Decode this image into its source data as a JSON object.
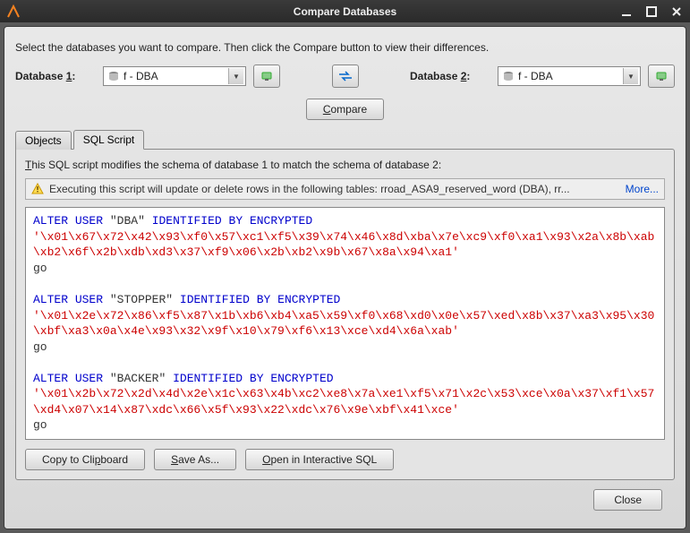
{
  "window": {
    "title": "Compare Databases"
  },
  "instruction": "Select the databases you want to compare. Then click the Compare button to view their differences.",
  "db1": {
    "label_pre": "Database ",
    "label_u": "1",
    "label_post": ":",
    "value": "f - DBA"
  },
  "db2": {
    "label_pre": "Database ",
    "label_u": "2",
    "label_post": ":",
    "value": "f - DBA"
  },
  "compare_btn": "Compare",
  "tabs": {
    "objects": "Objects",
    "sql": "SQL Script"
  },
  "panel_desc_pre": "T",
  "panel_desc_rest": "his SQL script modifies the schema of database 1 to match the schema of database 2:",
  "warning_text": "Executing this script will update or delete rows in the following tables: rroad_ASA9_reserved_word (DBA), rr...",
  "warning_more": "More...",
  "sql": {
    "l1a": "ALTER",
    "l1b": "USER",
    "l1c": "\"DBA\"",
    "l1d": "IDENTIFIED",
    "l1e": "BY",
    "l1f": "ENCRYPTED",
    "s1": "'\\x01\\x67\\x72\\x42\\x93\\xf0\\x57\\xc1\\xf5\\x39\\x74\\x46\\x8d\\xba\\x7e\\xc9\\xf0\\xa1\\x93\\x2a\\x8b\\xab\\xb2\\x6f\\x2b\\xdb\\xd3\\x37\\xf9\\x06\\x2b\\xb2\\x9b\\x67\\x8a\\x94\\xa1'",
    "g1": "go",
    "l2a": "ALTER",
    "l2b": "USER",
    "l2c": "\"STOPPER\"",
    "l2d": "IDENTIFIED",
    "l2e": "BY",
    "l2f": "ENCRYPTED",
    "s2": "'\\x01\\x2e\\x72\\x86\\xf5\\x87\\x1b\\xb6\\xb4\\xa5\\x59\\xf0\\x68\\xd0\\x0e\\x57\\xed\\x8b\\x37\\xa3\\x95\\x30\\xbf\\xa3\\x0a\\x4e\\x93\\x32\\x9f\\x10\\x79\\xf6\\x13\\xce\\xd4\\x6a\\xab'",
    "g2": "go",
    "l3a": "ALTER",
    "l3b": "USER",
    "l3c": "\"BACKER\"",
    "l3d": "IDENTIFIED",
    "l3e": "BY",
    "l3f": "ENCRYPTED",
    "s3": "'\\x01\\x2b\\x72\\x2d\\x4d\\x2e\\x1c\\x63\\x4b\\xc2\\xe8\\x7a\\xe1\\xf5\\x71\\x2c\\x53\\xce\\x0a\\x37\\xf1\\x57\\xd4\\x07\\x14\\x87\\xdc\\x66\\x5f\\x93\\x22\\xdc\\x76\\x9e\\xbf\\x41\\xce'",
    "g3": "go"
  },
  "buttons": {
    "copy": "Copy to Cli",
    "copy_u": "p",
    "copy2": "board",
    "save_u": "S",
    "save": "ave As...",
    "open_u": "O",
    "open": "pen in Interactive SQL",
    "close": "Close"
  }
}
